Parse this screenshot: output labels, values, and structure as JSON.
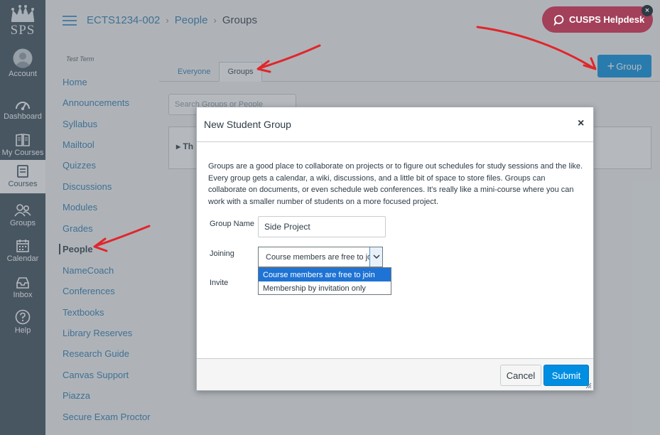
{
  "global_nav": {
    "logo_text": "SPS",
    "items": [
      {
        "label": "Account",
        "icon": "account-icon"
      },
      {
        "label": "Dashboard",
        "icon": "dashboard-icon"
      },
      {
        "label": "My Courses",
        "icon": "courses-book-icon"
      },
      {
        "label": "Courses",
        "icon": "courses-icon",
        "active": true
      },
      {
        "label": "Groups",
        "icon": "groups-icon"
      },
      {
        "label": "Calendar",
        "icon": "calendar-icon"
      },
      {
        "label": "Inbox",
        "icon": "inbox-icon"
      },
      {
        "label": "Help",
        "icon": "help-icon"
      }
    ]
  },
  "header": {
    "breadcrumbs": [
      "ECTS1234-002",
      "People",
      "Groups"
    ]
  },
  "course_nav": {
    "term": "Test Term",
    "items": [
      {
        "label": "Home"
      },
      {
        "label": "Announcements"
      },
      {
        "label": "Syllabus"
      },
      {
        "label": "Mailtool"
      },
      {
        "label": "Quizzes"
      },
      {
        "label": "Discussions"
      },
      {
        "label": "Modules"
      },
      {
        "label": "Grades"
      },
      {
        "label": "People",
        "active": true
      },
      {
        "label": "NameCoach"
      },
      {
        "label": "Conferences"
      },
      {
        "label": "Textbooks"
      },
      {
        "label": "Library Reserves"
      },
      {
        "label": "Research Guide"
      },
      {
        "label": "Canvas Support"
      },
      {
        "label": "Piazza"
      },
      {
        "label": "Secure Exam Proctor"
      }
    ]
  },
  "main": {
    "tabs": [
      {
        "label": "Everyone"
      },
      {
        "label": "Groups",
        "active": true
      }
    ],
    "add_group_label": "Group",
    "search_placeholder": "Search Groups or People",
    "group_panel_prefix": "Th"
  },
  "helpdesk": {
    "label": "CUSPS Helpdesk",
    "close": "×",
    "color": "#a3405a"
  },
  "dialog": {
    "title": "New Student Group",
    "close": "×",
    "description": "Groups are a good place to collaborate on projects or to figure out schedules for study sessions and the like. Every group gets a calendar, a wiki, discussions, and a little bit of space to store files. Groups can collaborate on documents, or even schedule web conferences. It's really like a mini-course where you can work with a smaller number of students on a more focused project.",
    "group_name_label": "Group Name",
    "group_name_value": "Side Project",
    "joining_label": "Joining",
    "joining_value": "Course members are free to join",
    "joining_options": [
      "Course members are free to join",
      "Membership by invitation only"
    ],
    "invite_label": "Invite",
    "cancel_label": "Cancel",
    "submit_label": "Submit"
  },
  "colors": {
    "nav_bg": "#394b58",
    "primary": "#008ee2",
    "link": "#2a7ab0",
    "annotation": "#e0262b"
  }
}
